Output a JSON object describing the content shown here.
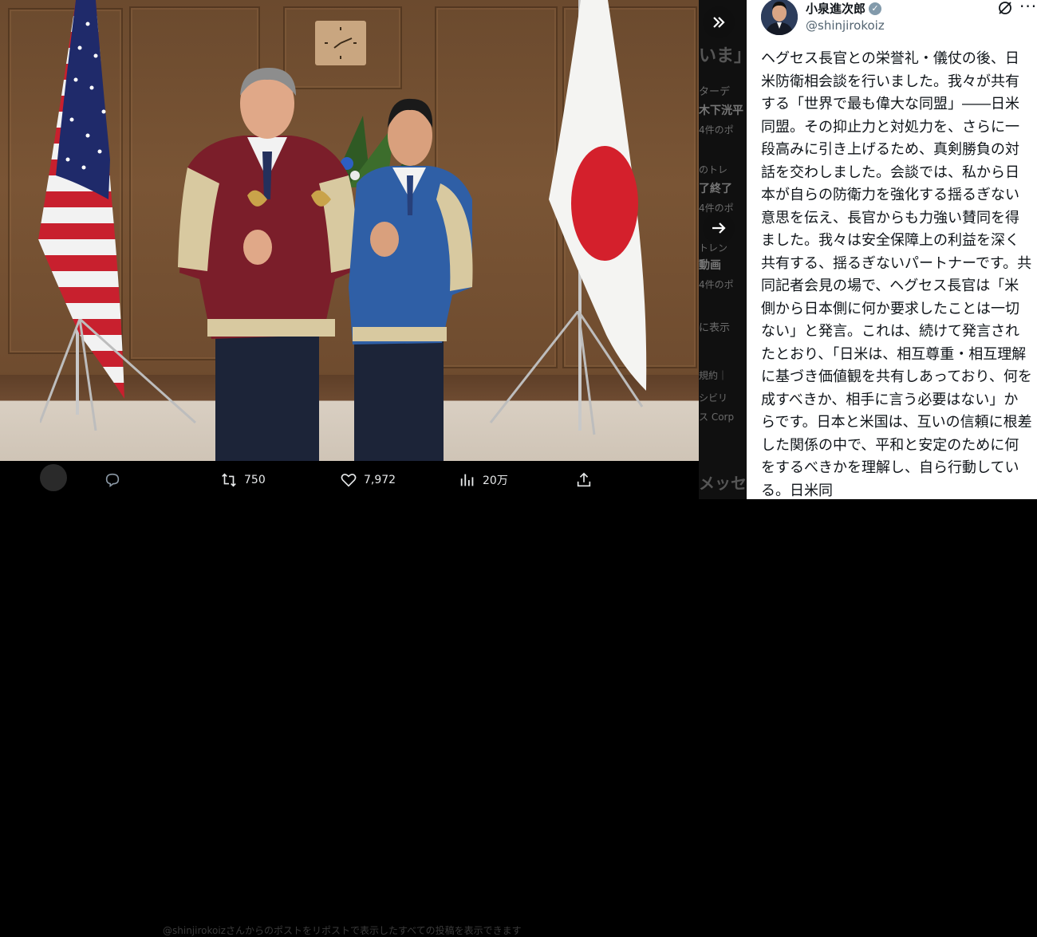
{
  "tweet": {
    "author_name": "小泉進次郎",
    "verified_icon": "verified-badge-icon",
    "handle": "@shinjirokoiz",
    "text": "ヘグセス長官との栄誉礼・儀仗の後、日米防衛相会談を行いました。我々が共有する「世界で最も偉大な同盟」――日米同盟。その抑止力と対処力を、さらに一段高みに引き上げるため、真剣勝負の対話を交わしました。会談では、私から日本が自らの防衛力を強化する揺るぎない意思を伝え、長官からも力強い賛同を得ました。我々は安全保障上の利益を深く共有する、揺るぎないパートナーです。共同記者会見の場で、ヘグセス長官は「米側から日本側に何か要求したことは一切ない」と発言。これは、続けて発言されたとおり、「日米は、相互尊重・相互理解に基づき価値観を共有しあっており、何を成すべきか、相手に言う必要はない」からです。日本と米国は、互いの信頼に根差した関係の中で、平和と安定のために何をするべきかを理解し、自ら行動している。日米同"
  },
  "actions": {
    "reply_icon": "reply-icon",
    "retweet_count": "750",
    "like_count": "7,972",
    "views_count": "20万",
    "share_icon": "share-icon"
  },
  "viewer": {
    "collapse_icon": "chevron-double-right-icon",
    "next_icon": "arrow-right-icon"
  },
  "background_ghost": {
    "line1": "いま」",
    "line2": "ターデ",
    "line3": "木下洸平",
    "line4": "4件のポ",
    "line5": "のトレ",
    "line6": "了終了",
    "line7": "4件のポ",
    "line8": "トレン",
    "line9": "動画",
    "line10": "4件のポ",
    "line11": "に表示",
    "line12": "規約｜",
    "line13": "シビリ",
    "line14": "ス Corp",
    "line15": "メッセ",
    "bottom": "@shinjirokoizさんからのポストをリポストで表示したすべての投稿を表示できます"
  },
  "colors": {
    "text": "#0f1419",
    "secondary": "#536471",
    "action_text": "#e7e9ea"
  }
}
